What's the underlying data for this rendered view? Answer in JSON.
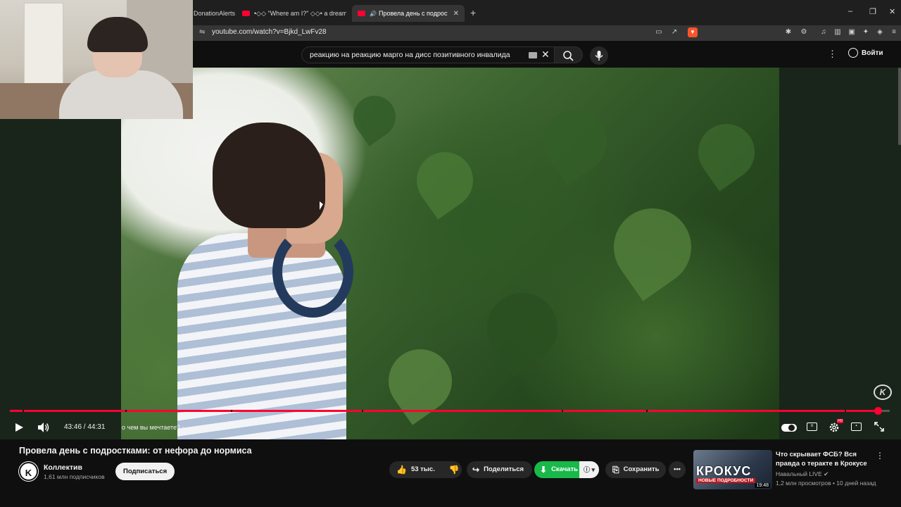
{
  "browser": {
    "tabs": [
      {
        "label": "DonationAlerts"
      },
      {
        "label": "•◇◇ \"Where am I?\" ◇◇• a dreamcore"
      },
      {
        "label": "Провела день с подростками"
      }
    ],
    "url": "youtube.com/watch?v=Bjkd_LwFv28"
  },
  "header": {
    "search_query": "реакцию на реакцию марго на дисс позитивного инвалида",
    "signin_label": "Войти"
  },
  "player": {
    "progress_fraction": 0.986,
    "time_label": "43:46 / 44:31",
    "chapter_label": "о чем вы мечтаете?",
    "watermark": "K"
  },
  "video": {
    "title": "Провела день с подростками: от нефора до нормиса",
    "channel_name": "Коллектив",
    "channel_subs": "1,61 млн подписчиков",
    "channel_initial": "K",
    "subscribe_label": "Подписаться",
    "likes": "53 тыс.",
    "share_label": "Поделиться",
    "download_label": "Скачать",
    "save_label": "Сохранить"
  },
  "recommended": {
    "thumb_big": "КРОКУС",
    "thumb_small": "НОВЫЕ ПОДРОБНОСТИ",
    "duration": "19:48",
    "title": "Что скрывает ФСБ? Вся правда о теракте в Крокусе",
    "channel": "Навальный LIVE",
    "meta": "1,2 млн просмотров • 10 дней назад"
  },
  "colors": {
    "accent": "#ff0033",
    "download": "#19b84a",
    "background": "#0f0f0f"
  }
}
